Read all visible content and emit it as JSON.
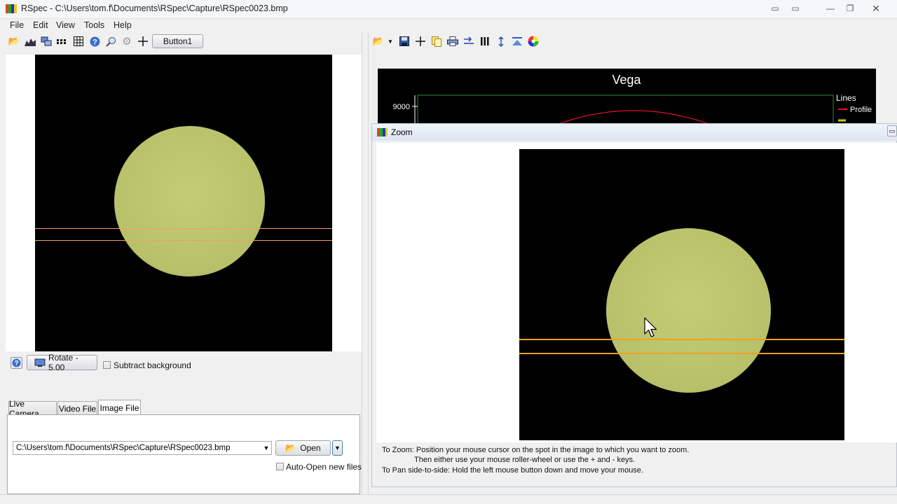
{
  "window": {
    "title": "RSpec - C:\\Users\\tom.f\\Documents\\RSpec\\Capture\\RSpec0023.bmp"
  },
  "menu": {
    "items": [
      {
        "label": "File"
      },
      {
        "label": "Edit"
      },
      {
        "label": "View"
      },
      {
        "label": "Tools"
      },
      {
        "label": "Help"
      }
    ]
  },
  "left_toolbar": {
    "icons": [
      "open-folder-icon",
      "chart-icon",
      "windows-icon",
      "dots-icon",
      "grid-icon",
      "help-icon",
      "zoom-icon",
      "settings-icon",
      "crosshair-icon"
    ],
    "button1_label": "Button1"
  },
  "right_toolbar": {
    "icons": [
      "open-folder-icon",
      "dropdown-arrow-icon",
      "save-icon",
      "crosshair-icon",
      "copy-icon",
      "print-icon",
      "export-icon",
      "columns-icon",
      "vertical-arrow-icon",
      "baseline-icon",
      "color-wheel-icon"
    ]
  },
  "image_controls": {
    "rotate_label": "Rotate - 5.00",
    "subtract_background_label": "Subtract background",
    "subtract_background_checked": false
  },
  "tabs": [
    {
      "label": "Live Camera",
      "active": false
    },
    {
      "label": "Video File",
      "active": false
    },
    {
      "label": "Image File",
      "active": true
    }
  ],
  "image_file": {
    "path": "C:\\Users\\tom.f\\Documents\\RSpec\\Capture\\RSpec0023.bmp",
    "open_label": "Open",
    "auto_open_label": "Auto-Open new files",
    "auto_open_checked": false
  },
  "chart_data": {
    "type": "line",
    "title": "Vega",
    "yticks": [
      9000
    ],
    "legend_title": "Lines",
    "series": [
      {
        "name": "Profile",
        "color": "#e0102a"
      }
    ],
    "legend_placement": "right"
  },
  "zoom_window": {
    "title": "Zoom",
    "help_line1": "To Zoom: Position your mouse cursor on the spot in the image to which you want to zoom.",
    "help_line2": "Then either use your mouse roller-wheel or use the + and - keys.",
    "help_line3": "To Pan side-to-side:  Hold the left mouse button down and move your mouse."
  },
  "colors": {
    "star_disk": "#bcc56e",
    "selection_lines_left": "#f0a060",
    "selection_lines_zoom": "#f0a020",
    "chart_profile": "#e0102a"
  }
}
